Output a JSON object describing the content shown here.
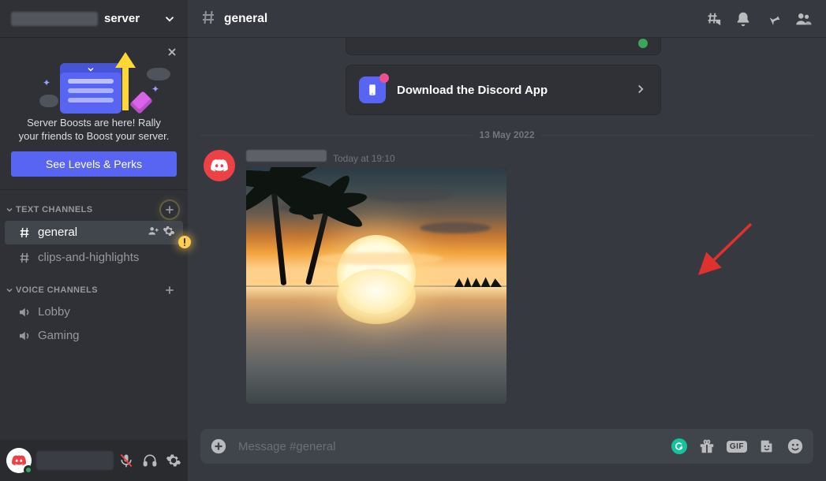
{
  "server": {
    "name_suffix": "server"
  },
  "boost": {
    "text": "Server Boosts are here! Rally your friends to Boost your server.",
    "button": "See Levels & Perks"
  },
  "sections": {
    "text_channels_label": "TEXT CHANNELS",
    "voice_channels_label": "VOICE CHANNELS"
  },
  "channels": {
    "text": [
      {
        "name": "general",
        "active": true
      },
      {
        "name": "clips-and-highlights",
        "active": false
      }
    ],
    "voice": [
      {
        "name": "Lobby"
      },
      {
        "name": "Gaming"
      }
    ]
  },
  "chat": {
    "channel_name": "general",
    "download_card_label": "Download the Discord App",
    "date_divider": "13 May 2022",
    "message_timestamp": "Today at 19:10",
    "input_placeholder": "Message #general"
  }
}
